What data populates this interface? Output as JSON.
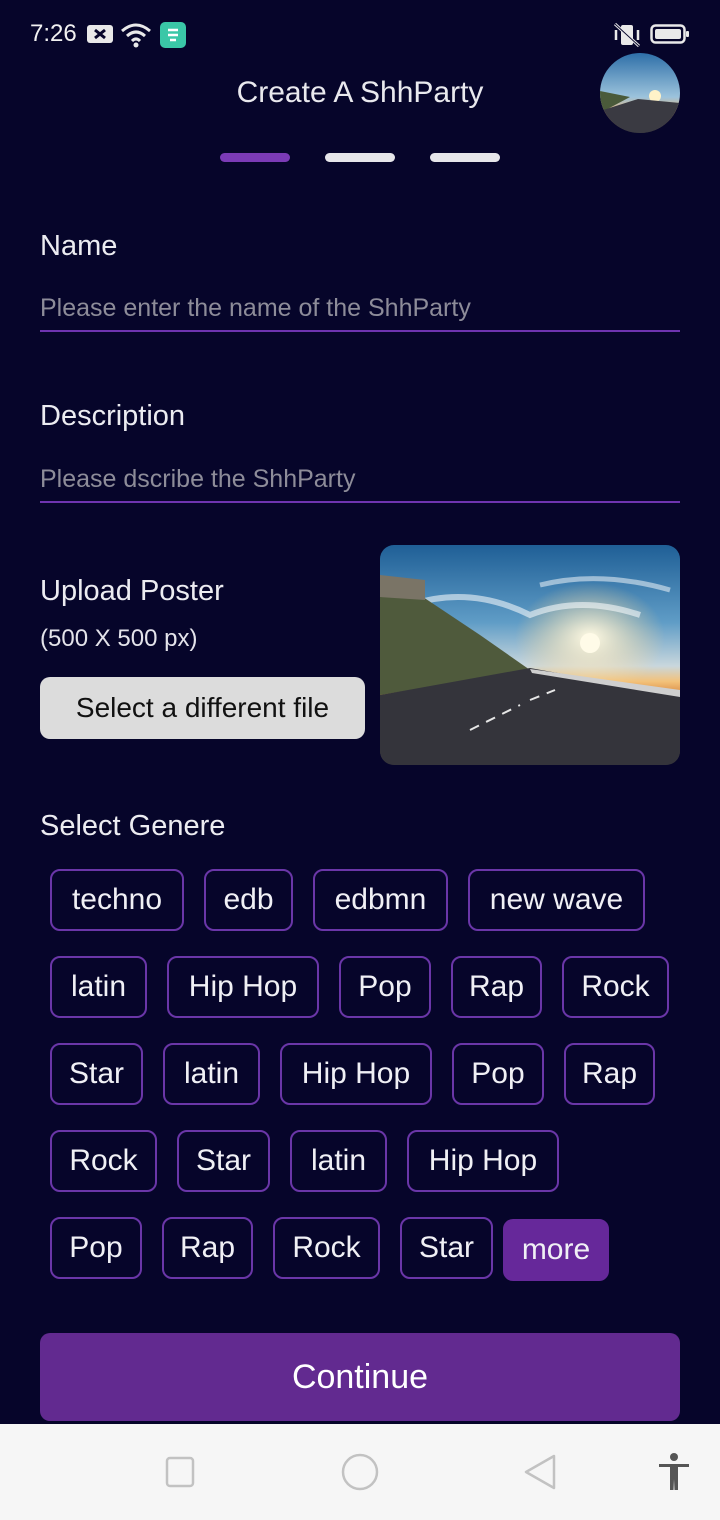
{
  "status_bar": {
    "time": "7:26"
  },
  "header": {
    "title": "Create A ShhParty"
  },
  "steps": {
    "total": 3,
    "current": 1
  },
  "form": {
    "name": {
      "label": "Name",
      "placeholder": "Please enter the name of the ShhParty",
      "value": ""
    },
    "description": {
      "label": "Description",
      "placeholder": "Please dscribe the ShhParty",
      "value": ""
    },
    "upload": {
      "title": "Upload Poster",
      "subtitle": "(500 X 500 px)",
      "button_label": "Select a different file"
    },
    "genre": {
      "title": "Select Genere",
      "chips": [
        "techno",
        "edb",
        "edbmn",
        "new wave",
        "latin",
        "Hip Hop",
        "Pop",
        "Rap",
        "Rock",
        "Star",
        "latin",
        "Hip Hop",
        "Pop",
        "Rap",
        "Rock",
        "Star",
        "latin",
        "Hip Hop",
        "Pop",
        "Rap",
        "Rock",
        "Star"
      ],
      "more_label": "more"
    }
  },
  "continue_label": "Continue",
  "colors": {
    "background": "#06052a",
    "accent": "#7b3bb6",
    "button": "#622a90",
    "chip_border": "#6a36a8"
  },
  "icons": [
    "notification-icon",
    "wifi-icon",
    "app-notification-icon",
    "mute-vibrate-icon",
    "battery-icon",
    "nav-recent-icon",
    "nav-home-icon",
    "nav-back-icon",
    "accessibility-icon"
  ]
}
